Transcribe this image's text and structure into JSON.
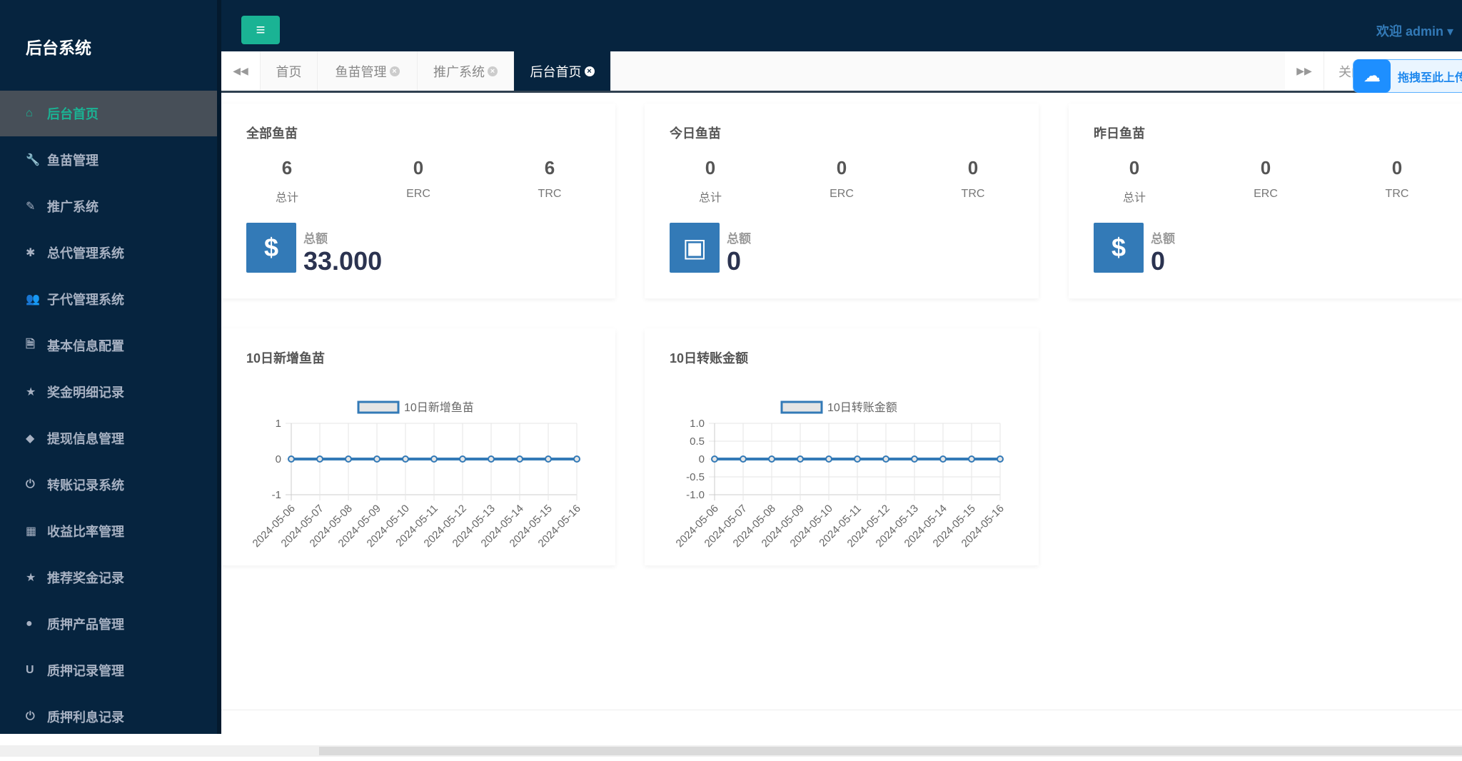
{
  "sidebar": {
    "brand": "后台系统",
    "items": [
      {
        "label": "后台首页",
        "icon": "home-icon",
        "glyph": "⌂",
        "active": true
      },
      {
        "label": "鱼苗管理",
        "icon": "wrench-icon",
        "glyph": "🔧"
      },
      {
        "label": "推广系统",
        "icon": "edit-icon",
        "glyph": "✎"
      },
      {
        "label": "总代管理系统",
        "icon": "asterisk-icon",
        "glyph": "✱"
      },
      {
        "label": "子代管理系统",
        "icon": "users-icon",
        "glyph": "👥"
      },
      {
        "label": "基本信息配置",
        "icon": "file-icon",
        "glyph": "🗎"
      },
      {
        "label": "奖金明细记录",
        "icon": "star-icon",
        "glyph": "★"
      },
      {
        "label": "提现信息管理",
        "icon": "tag-icon",
        "glyph": "◆"
      },
      {
        "label": "转账记录系统",
        "icon": "power-icon",
        "glyph": "⏻"
      },
      {
        "label": "收益比率管理",
        "icon": "calendar-icon",
        "glyph": "▦"
      },
      {
        "label": "推荐奖金记录",
        "icon": "star-icon",
        "glyph": "★"
      },
      {
        "label": "质押产品管理",
        "icon": "comment-icon",
        "glyph": "●"
      },
      {
        "label": "质押记录管理",
        "icon": "magnet-icon",
        "glyph": "U"
      },
      {
        "label": "质押利息记录",
        "icon": "power-icon",
        "glyph": "⏻"
      }
    ]
  },
  "header": {
    "welcome": "欢迎 admin ▾",
    "menu_glyph": "≡"
  },
  "tabs": {
    "prev": "◀◀",
    "next": "▶▶",
    "close_label": "关闭",
    "items": [
      {
        "label": "首页",
        "closable": false
      },
      {
        "label": "鱼苗管理",
        "closable": true
      },
      {
        "label": "推广系统",
        "closable": true
      },
      {
        "label": "后台首页",
        "closable": true,
        "active": true
      }
    ]
  },
  "upload_widget": {
    "label": "拖拽至此上传"
  },
  "cards": [
    {
      "title": "全部鱼苗",
      "stats": [
        {
          "value": "6",
          "label": "总计"
        },
        {
          "value": "0",
          "label": "ERC"
        },
        {
          "value": "6",
          "label": "TRC"
        }
      ],
      "total_label": "总额",
      "total": "33.000",
      "icon": "dollar-icon",
      "glyph": "$"
    },
    {
      "title": "今日鱼苗",
      "stats": [
        {
          "value": "0",
          "label": "总计"
        },
        {
          "value": "0",
          "label": "ERC"
        },
        {
          "value": "0",
          "label": "TRC"
        }
      ],
      "total_label": "总额",
      "total": "0",
      "icon": "archive-icon",
      "glyph": "▣"
    },
    {
      "title": "昨日鱼苗",
      "stats": [
        {
          "value": "0",
          "label": "总计"
        },
        {
          "value": "0",
          "label": "ERC"
        },
        {
          "value": "0",
          "label": "TRC"
        }
      ],
      "total_label": "总额",
      "total": "0",
      "icon": "dollar-icon",
      "glyph": "$"
    }
  ],
  "colors": {
    "sidebar": "#06243f",
    "accent": "#1ab394",
    "primary": "#337ab7"
  },
  "chart_data": [
    {
      "type": "line",
      "title": "10日新增鱼苗",
      "categories": [
        "2024-05-06",
        "2024-05-07",
        "2024-05-08",
        "2024-05-09",
        "2024-05-10",
        "2024-05-11",
        "2024-05-12",
        "2024-05-13",
        "2024-05-14",
        "2024-05-15",
        "2024-05-16"
      ],
      "series": [
        {
          "name": "10日新增鱼苗",
          "values": [
            0,
            0,
            0,
            0,
            0,
            0,
            0,
            0,
            0,
            0,
            0
          ]
        }
      ],
      "ylim": [
        -1,
        1
      ],
      "yticks": [
        "1",
        "0",
        "-1"
      ],
      "legend": "top",
      "grid": true
    },
    {
      "type": "line",
      "title": "10日转账金额",
      "categories": [
        "2024-05-06",
        "2024-05-07",
        "2024-05-08",
        "2024-05-09",
        "2024-05-10",
        "2024-05-11",
        "2024-05-12",
        "2024-05-13",
        "2024-05-14",
        "2024-05-15",
        "2024-05-16"
      ],
      "series": [
        {
          "name": "10日转账金额",
          "values": [
            0,
            0,
            0,
            0,
            0,
            0,
            0,
            0,
            0,
            0,
            0
          ]
        }
      ],
      "ylim": [
        -1,
        1
      ],
      "yticks": [
        "1.0",
        "0.5",
        "0",
        "-0.5",
        "-1.0"
      ],
      "legend": "top",
      "grid": true
    }
  ]
}
